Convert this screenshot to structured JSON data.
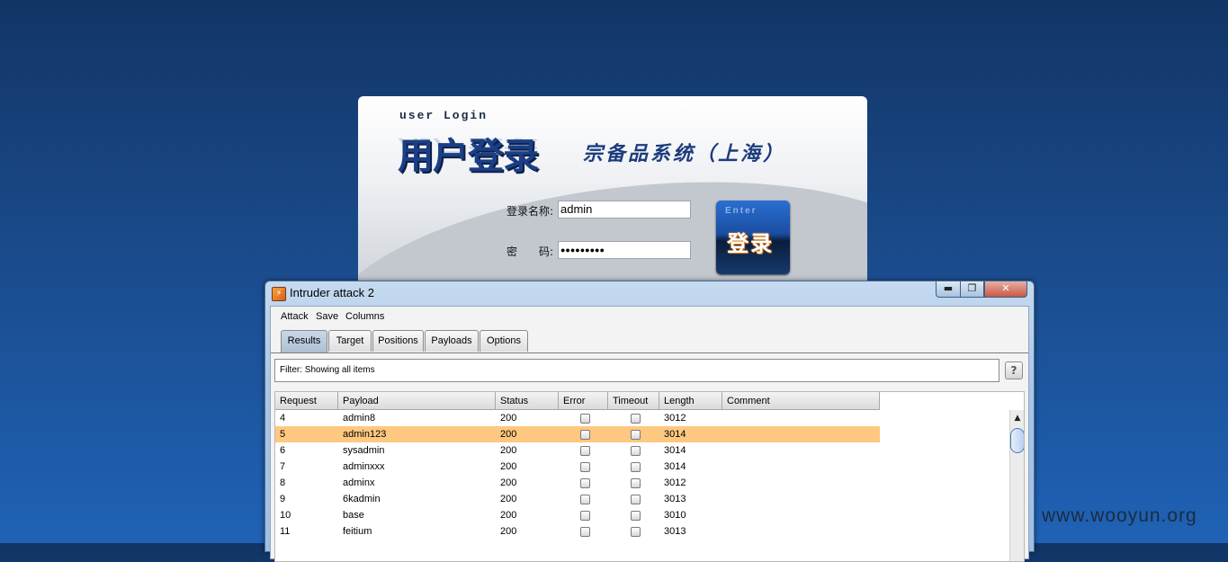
{
  "login": {
    "user_login_label": "user Login",
    "logo_text": "用户登录",
    "system_name": "宗备品系统（上海）",
    "username_label": "登录名称:",
    "username_value": "admin",
    "password_label": "密　　码:",
    "password_value": "●●●●●●●●●",
    "enter_small": "Enter",
    "enter_big": "登录"
  },
  "window": {
    "title": "Intruder attack 2",
    "minimize": "▬",
    "maximize": "❐",
    "close": "✕"
  },
  "menu": {
    "attack": "Attack",
    "save": "Save",
    "columns": "Columns"
  },
  "tabs": [
    "Results",
    "Target",
    "Positions",
    "Payloads",
    "Options"
  ],
  "filter": {
    "text": "Filter:  Showing all items"
  },
  "help": "?",
  "table": {
    "headers": [
      "Request",
      "Payload",
      "Status",
      "Error",
      "Timeout",
      "Length",
      "Comment"
    ],
    "rows": [
      {
        "request": "4",
        "payload": "admin8",
        "status": "200",
        "length": "3012",
        "comment": ""
      },
      {
        "request": "5",
        "payload": "admin123",
        "status": "200",
        "length": "3014",
        "comment": ""
      },
      {
        "request": "6",
        "payload": "sysadmin",
        "status": "200",
        "length": "3014",
        "comment": ""
      },
      {
        "request": "7",
        "payload": "adminxxx",
        "status": "200",
        "length": "3014",
        "comment": ""
      },
      {
        "request": "8",
        "payload": "adminx",
        "status": "200",
        "length": "3012",
        "comment": ""
      },
      {
        "request": "9",
        "payload": "6kadmin",
        "status": "200",
        "length": "3013",
        "comment": ""
      },
      {
        "request": "10",
        "payload": "base",
        "status": "200",
        "length": "3010",
        "comment": ""
      },
      {
        "request": "11",
        "payload": "feitium",
        "status": "200",
        "length": "3013",
        "comment": ""
      }
    ],
    "selected_row": 1,
    "selected_color": "#ffc880"
  },
  "scroll_up": "▲",
  "watermark": "www.wooyun.org"
}
